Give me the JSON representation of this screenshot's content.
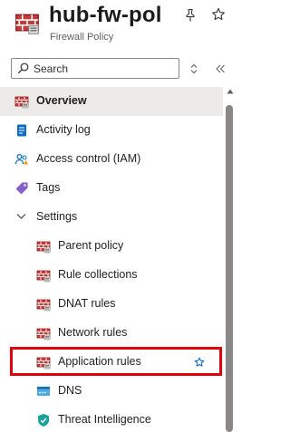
{
  "resource": {
    "title": "hub-fw-pol",
    "subtitle": "Firewall Policy"
  },
  "search": {
    "placeholder": "Search"
  },
  "nav": {
    "overview": "Overview",
    "activity_log": "Activity log",
    "access_control": "Access control (IAM)",
    "tags": "Tags",
    "settings": "Settings",
    "parent_policy": "Parent policy",
    "rule_collections": "Rule collections",
    "dnat_rules": "DNAT rules",
    "network_rules": "Network rules",
    "application_rules": "Application rules",
    "dns": "DNS",
    "threat_intelligence": "Threat Intelligence"
  },
  "colors": {
    "highlight": "#e0000b",
    "selected_bg": "#edebe9",
    "accent_star": "#0f6cbd"
  }
}
